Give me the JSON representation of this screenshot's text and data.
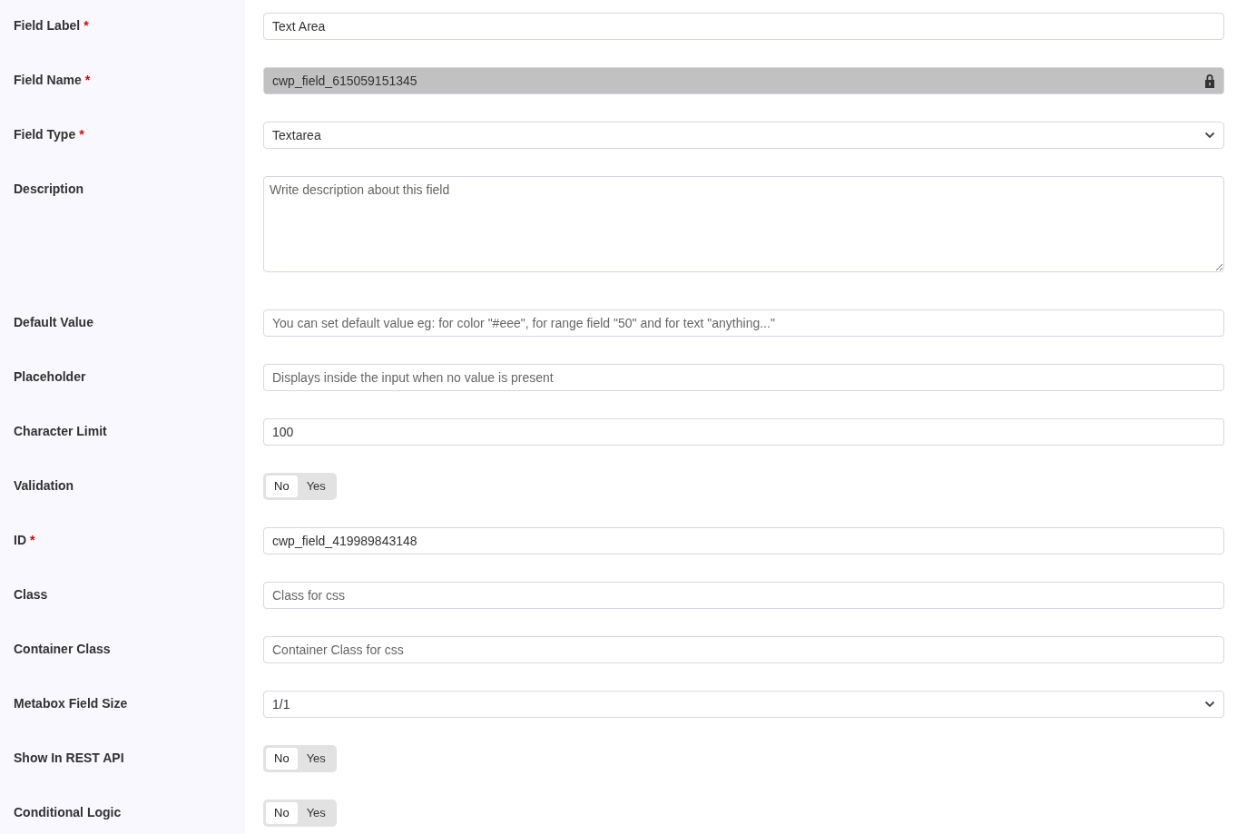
{
  "fields": [
    {
      "label": "Field Label",
      "required": true,
      "kind": "text",
      "value": "Text Area"
    },
    {
      "label": "Field Name",
      "required": true,
      "kind": "locked",
      "value": "cwp_field_615059151345"
    },
    {
      "label": "Field Type",
      "required": true,
      "kind": "select",
      "value": "Textarea"
    },
    {
      "label": "Description",
      "required": false,
      "kind": "textarea",
      "placeholder": "Write description about this field"
    },
    {
      "label": "Default Value",
      "required": false,
      "kind": "text",
      "placeholder": "You can set default value eg: for color \"#eee\", for range field \"50\" and for text \"anything...\""
    },
    {
      "label": "Placeholder",
      "required": false,
      "kind": "text",
      "placeholder": "Displays inside the input when no value is present"
    },
    {
      "label": "Character Limit",
      "required": false,
      "kind": "text",
      "value": "100"
    },
    {
      "label": "Validation",
      "required": false,
      "kind": "toggle",
      "options": [
        {
          "label": "No",
          "selected": true
        },
        {
          "label": "Yes",
          "selected": false
        }
      ]
    },
    {
      "label": "ID",
      "required": true,
      "kind": "text",
      "value": "cwp_field_419989843148"
    },
    {
      "label": "Class",
      "required": false,
      "kind": "text",
      "placeholder": "Class for css"
    },
    {
      "label": "Container Class",
      "required": false,
      "kind": "text",
      "placeholder": "Container Class for css"
    },
    {
      "label": "Metabox Field Size",
      "required": false,
      "kind": "select",
      "value": "1/1"
    },
    {
      "label": "Show In REST API",
      "required": false,
      "kind": "toggle",
      "options": [
        {
          "label": "No",
          "selected": true
        },
        {
          "label": "Yes",
          "selected": false
        }
      ]
    },
    {
      "label": "Conditional Logic",
      "required": false,
      "kind": "toggle",
      "options": [
        {
          "label": "No",
          "selected": true
        },
        {
          "label": "Yes",
          "selected": false
        }
      ]
    }
  ],
  "required_mark": "*"
}
